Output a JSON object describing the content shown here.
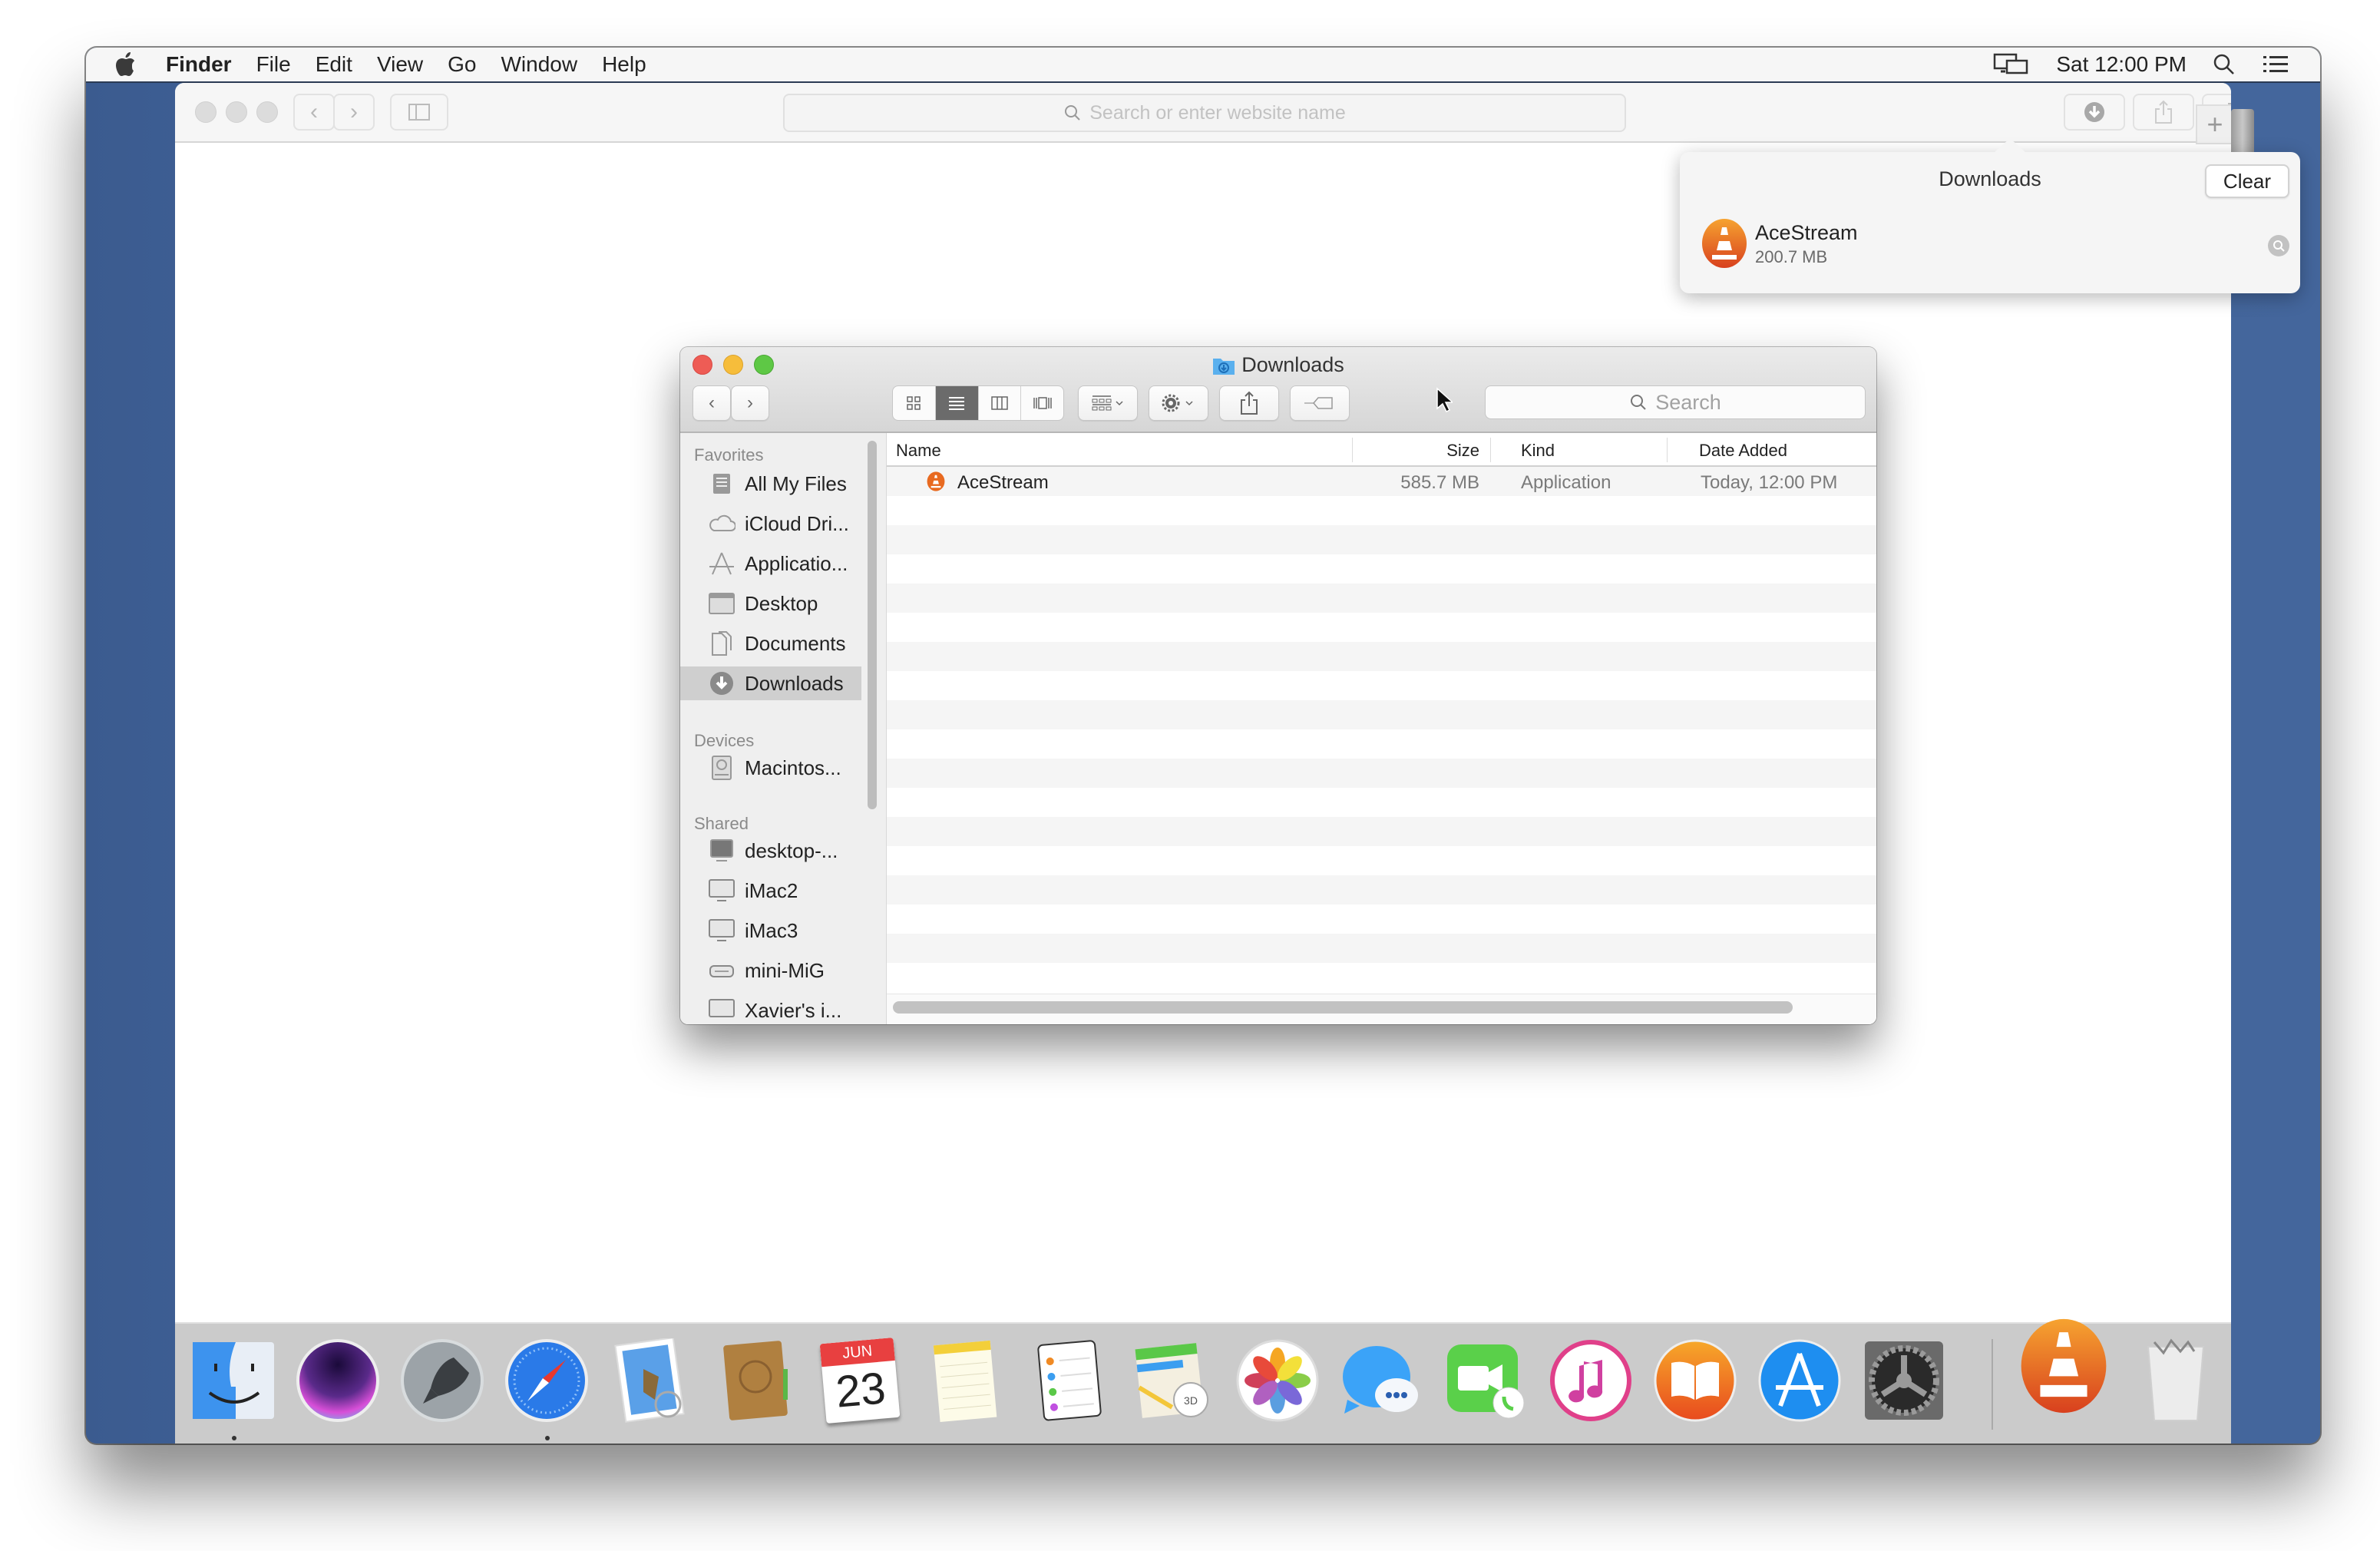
{
  "menubar": {
    "app_name": "Finder",
    "items": [
      "File",
      "Edit",
      "View",
      "Go",
      "Window",
      "Help"
    ],
    "clock": "Sat 12:00 PM",
    "icons": [
      "apple-icon",
      "screen-mirroring-icon",
      "spotlight-search-icon",
      "notification-center-icon"
    ]
  },
  "safari": {
    "url_placeholder": "Search or enter website name",
    "toolbar_icons": [
      "back-icon",
      "forward-icon",
      "sidebar-icon",
      "downloads-icon",
      "share-icon",
      "tabs-icon",
      "new-tab-icon"
    ]
  },
  "downloads_popover": {
    "title": "Downloads",
    "clear_label": "Clear",
    "items": [
      {
        "name": "AceStream",
        "size": "200.7 MB",
        "icon": "vlc-cone-icon"
      }
    ]
  },
  "finder": {
    "title": "Downloads",
    "search_placeholder": "Search",
    "view_modes": [
      "icon",
      "list",
      "column",
      "cover-flow"
    ],
    "active_view": "list",
    "sidebar": {
      "sections": [
        {
          "title": "Favorites",
          "items": [
            {
              "label": "All My Files",
              "icon": "all-files-icon"
            },
            {
              "label": "iCloud Dri...",
              "icon": "cloud-icon"
            },
            {
              "label": "Applicatio...",
              "icon": "applications-icon"
            },
            {
              "label": "Desktop",
              "icon": "desktop-icon"
            },
            {
              "label": "Documents",
              "icon": "documents-icon"
            },
            {
              "label": "Downloads",
              "icon": "downloads-icon",
              "selected": true
            }
          ]
        },
        {
          "title": "Devices",
          "items": [
            {
              "label": "Macintos...",
              "icon": "hard-drive-icon"
            }
          ]
        },
        {
          "title": "Shared",
          "items": [
            {
              "label": "desktop-...",
              "icon": "pc-icon"
            },
            {
              "label": "iMac2",
              "icon": "imac-icon"
            },
            {
              "label": "iMac3",
              "icon": "imac-icon"
            },
            {
              "label": "mini-MiG",
              "icon": "mac-mini-icon"
            },
            {
              "label": "Xavier's i...",
              "icon": "imac-icon"
            }
          ]
        }
      ]
    },
    "columns": [
      "Name",
      "Size",
      "Kind",
      "Date Added"
    ],
    "files": [
      {
        "name": "AceStream",
        "size": "585.7 MB",
        "kind": "Application",
        "date_added": "Today, 12:00 PM"
      }
    ]
  },
  "dock": {
    "apps": [
      {
        "name": "Finder",
        "running": true
      },
      {
        "name": "Siri",
        "running": false
      },
      {
        "name": "Launchpad",
        "running": false
      },
      {
        "name": "Safari",
        "running": true
      },
      {
        "name": "Mail",
        "running": false
      },
      {
        "name": "Contacts",
        "running": false
      },
      {
        "name": "Calendar",
        "running": false,
        "month": "JUN",
        "day": "23"
      },
      {
        "name": "Notes",
        "running": false
      },
      {
        "name": "Reminders",
        "running": false
      },
      {
        "name": "Maps",
        "running": false
      },
      {
        "name": "Photos",
        "running": false
      },
      {
        "name": "Messages",
        "running": false
      },
      {
        "name": "FaceTime",
        "running": false
      },
      {
        "name": "iTunes",
        "running": false
      },
      {
        "name": "iBooks",
        "running": false
      },
      {
        "name": "App Store",
        "running": false
      },
      {
        "name": "System Preferences",
        "running": false
      }
    ],
    "right": [
      {
        "name": "AceStream"
      },
      {
        "name": "Trash"
      }
    ]
  },
  "colors": {
    "desktop": "#41639a",
    "close": "#ee5c55",
    "minimize": "#f6bd3b",
    "zoom": "#5ec845",
    "vlc_orange": "#f08a24",
    "selection_gray": "#cfcfcf"
  }
}
